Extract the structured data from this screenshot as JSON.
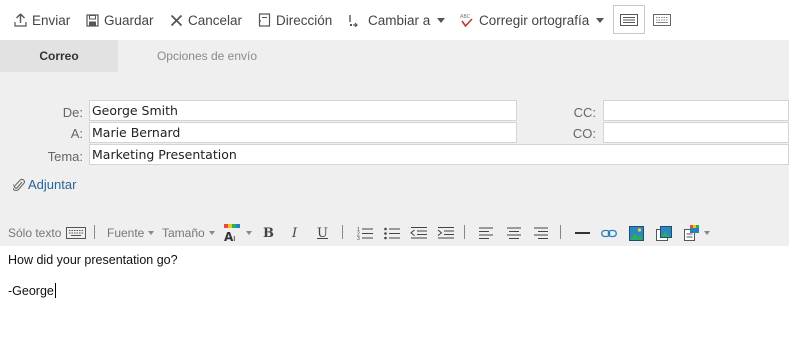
{
  "toolbar": {
    "send": "Enviar",
    "save": "Guardar",
    "cancel": "Cancelar",
    "address": "Dirección",
    "switch_to": "Cambiar a",
    "spellcheck": "Corregir ortografía"
  },
  "tabs": [
    {
      "label": "Correo",
      "active": true
    },
    {
      "label": "Opciones de envío",
      "active": false
    }
  ],
  "fields": {
    "from_label": "De:",
    "from_value": "George Smith",
    "to_label": "A:",
    "to_value": "Marie Bernard",
    "cc_label": "CC:",
    "cc_value": "",
    "bcc_label": "CO:",
    "bcc_value": "",
    "subject_label": "Tema:",
    "subject_value": "Marketing Presentation"
  },
  "attach": {
    "label": "Adjuntar"
  },
  "format_toolbar": {
    "plain_text": "Sólo texto",
    "font": "Fuente",
    "size": "Tamaño"
  },
  "body": {
    "lines": [
      "How did your presentation go?",
      "-George"
    ]
  },
  "colors": {
    "panel_bg": "#efefef",
    "active_tab_bg": "#e2e2e2",
    "link": "#2a6496",
    "spell_icon": "#c0392b"
  }
}
